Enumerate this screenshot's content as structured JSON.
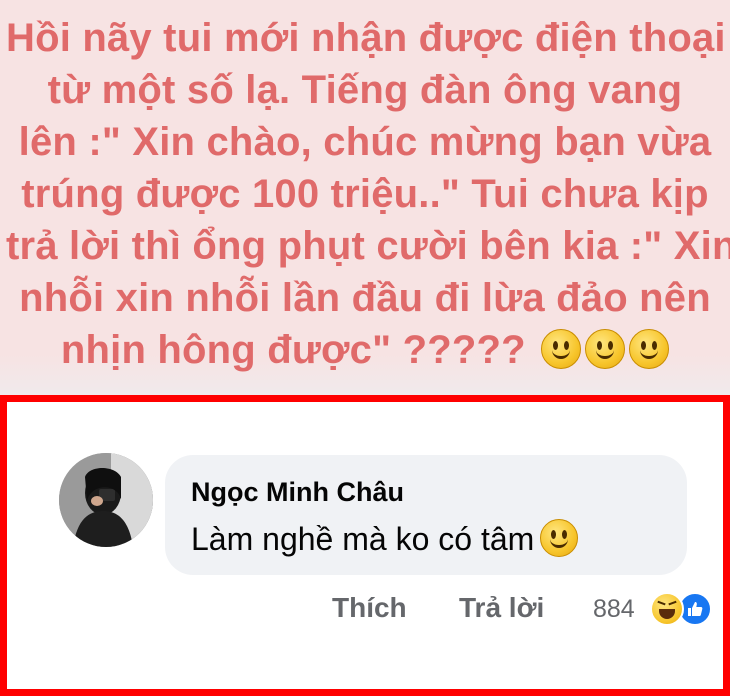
{
  "post": {
    "lines": [
      "Hồi nãy tui mới nhận được điện thoại",
      "từ một số lạ.  Tiếng đàn ông vang",
      "lên :\" Xin chào, chúc mừng bạn vừa",
      "trúng được 100 triệu..\" Tui chưa kịp",
      "trả lời thì ổng phụt cười bên kia :\" Xin",
      "nhỗi xin nhỗi lần đầu đi lừa đảo nên",
      "nhịn hông được\" ?????"
    ],
    "trailing_emoji": "slightly-smiling-face-icon",
    "emoji_count": 3,
    "text_color": "#e06a6a",
    "background_color": "#f7e3e3"
  },
  "comment": {
    "author": "Ngọc Minh Châu",
    "text": "Làm nghề mà ko có tâm",
    "text_emoji": "slightly-smiling-face-icon",
    "actions": {
      "like": "Thích",
      "reply": "Trả lời"
    },
    "reaction_count": "884",
    "reaction_icons": [
      "haha-reaction-icon",
      "like-reaction-icon"
    ]
  },
  "colors": {
    "frame": "#ff0000",
    "bubble": "#f0f2f5",
    "action_text": "#65676b",
    "like_blue": "#1877f2"
  }
}
